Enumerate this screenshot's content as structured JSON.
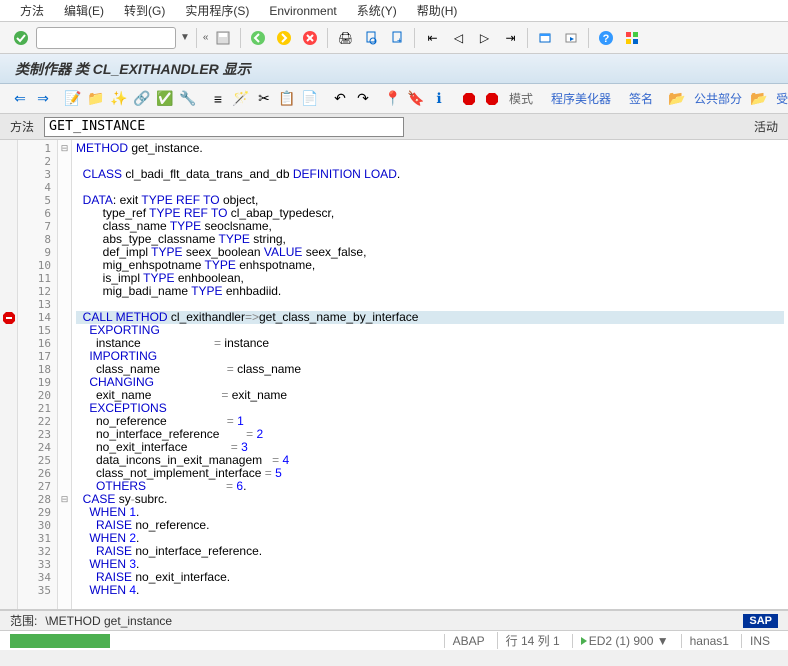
{
  "menu": {
    "items": [
      "方法",
      "编辑(E)",
      "转到(G)",
      "实用程序(S)",
      "Environment",
      "系统(Y)",
      "帮助(H)"
    ]
  },
  "title": "类制作器 类 CL_EXITHANDLER 显示",
  "toolbar2": {
    "pattern": "模式",
    "beautifier": "程序美化器",
    "signature": "签名",
    "public": "公共部分",
    "protected": "受保护"
  },
  "field": {
    "label": "方法",
    "value": "GET_INSTANCE",
    "active": "活动"
  },
  "code": {
    "lines": [
      [
        {
          "t": "METHOD",
          "c": "kw"
        },
        {
          "t": " get_instance."
        }
      ],
      [],
      [
        {
          "t": "  "
        },
        {
          "t": "CLASS",
          "c": "kw"
        },
        {
          "t": " cl_badi_flt_data_trans_and_db "
        },
        {
          "t": "DEFINITION LOAD",
          "c": "kw"
        },
        {
          "t": "."
        }
      ],
      [],
      [
        {
          "t": "  "
        },
        {
          "t": "DATA",
          "c": "kw"
        },
        {
          "t": ": exit "
        },
        {
          "t": "TYPE REF TO",
          "c": "kw"
        },
        {
          "t": " object,"
        }
      ],
      [
        {
          "t": "        type_ref "
        },
        {
          "t": "TYPE REF TO",
          "c": "kw"
        },
        {
          "t": " cl_abap_typedescr,"
        }
      ],
      [
        {
          "t": "        class_name "
        },
        {
          "t": "TYPE",
          "c": "kw"
        },
        {
          "t": " seoclsname,"
        }
      ],
      [
        {
          "t": "        abs_type_classname "
        },
        {
          "t": "TYPE",
          "c": "kw"
        },
        {
          "t": " string,"
        }
      ],
      [
        {
          "t": "        def_impl "
        },
        {
          "t": "TYPE",
          "c": "kw"
        },
        {
          "t": " seex_boolean "
        },
        {
          "t": "VALUE",
          "c": "kw"
        },
        {
          "t": " seex_false,"
        }
      ],
      [
        {
          "t": "        mig_enhspotname "
        },
        {
          "t": "TYPE",
          "c": "kw"
        },
        {
          "t": " enhspotname,"
        }
      ],
      [
        {
          "t": "        is_impl "
        },
        {
          "t": "TYPE",
          "c": "kw"
        },
        {
          "t": " enhboolean,"
        }
      ],
      [
        {
          "t": "        mig_badi_name "
        },
        {
          "t": "TYPE",
          "c": "kw"
        },
        {
          "t": " enhbadiid."
        }
      ],
      [],
      [
        {
          "t": "  "
        },
        {
          "t": "CALL METHOD",
          "c": "kw"
        },
        {
          "t": " cl_exithandler"
        },
        {
          "t": "=>",
          "c": "op"
        },
        {
          "t": "get_class_name_by_interface"
        }
      ],
      [
        {
          "t": "    "
        },
        {
          "t": "EXPORTING",
          "c": "kw"
        }
      ],
      [
        {
          "t": "      instance                      "
        },
        {
          "t": "=",
          "c": "op"
        },
        {
          "t": " instance"
        }
      ],
      [
        {
          "t": "    "
        },
        {
          "t": "IMPORTING",
          "c": "kw"
        }
      ],
      [
        {
          "t": "      class_name                    "
        },
        {
          "t": "=",
          "c": "op"
        },
        {
          "t": " class_name"
        }
      ],
      [
        {
          "t": "    "
        },
        {
          "t": "CHANGING",
          "c": "kw"
        }
      ],
      [
        {
          "t": "      exit_name                     "
        },
        {
          "t": "=",
          "c": "op"
        },
        {
          "t": " exit_name"
        }
      ],
      [
        {
          "t": "    "
        },
        {
          "t": "EXCEPTIONS",
          "c": "kw"
        }
      ],
      [
        {
          "t": "      no_reference                  "
        },
        {
          "t": "=",
          "c": "op"
        },
        {
          "t": " "
        },
        {
          "t": "1",
          "c": "num"
        }
      ],
      [
        {
          "t": "      no_interface_reference        "
        },
        {
          "t": "=",
          "c": "op"
        },
        {
          "t": " "
        },
        {
          "t": "2",
          "c": "num"
        }
      ],
      [
        {
          "t": "      no_exit_interface             "
        },
        {
          "t": "=",
          "c": "op"
        },
        {
          "t": " "
        },
        {
          "t": "3",
          "c": "num"
        }
      ],
      [
        {
          "t": "      data_incons_in_exit_managem   "
        },
        {
          "t": "=",
          "c": "op"
        },
        {
          "t": " "
        },
        {
          "t": "4",
          "c": "num"
        }
      ],
      [
        {
          "t": "      class_not_implement_interface "
        },
        {
          "t": "=",
          "c": "op"
        },
        {
          "t": " "
        },
        {
          "t": "5",
          "c": "num"
        }
      ],
      [
        {
          "t": "      "
        },
        {
          "t": "OTHERS",
          "c": "kw"
        },
        {
          "t": "                        "
        },
        {
          "t": "=",
          "c": "op"
        },
        {
          "t": " "
        },
        {
          "t": "6",
          "c": "num"
        },
        {
          "t": "."
        }
      ],
      [
        {
          "t": "  "
        },
        {
          "t": "CASE",
          "c": "kw"
        },
        {
          "t": " sy"
        },
        {
          "t": "-",
          "c": "op"
        },
        {
          "t": "subrc."
        }
      ],
      [
        {
          "t": "    "
        },
        {
          "t": "WHEN",
          "c": "kw"
        },
        {
          "t": " "
        },
        {
          "t": "1",
          "c": "num"
        },
        {
          "t": "."
        }
      ],
      [
        {
          "t": "      "
        },
        {
          "t": "RAISE",
          "c": "kw"
        },
        {
          "t": " no_reference."
        }
      ],
      [
        {
          "t": "    "
        },
        {
          "t": "WHEN",
          "c": "kw"
        },
        {
          "t": " "
        },
        {
          "t": "2",
          "c": "num"
        },
        {
          "t": "."
        }
      ],
      [
        {
          "t": "      "
        },
        {
          "t": "RAISE",
          "c": "kw"
        },
        {
          "t": " no_interface_reference."
        }
      ],
      [
        {
          "t": "    "
        },
        {
          "t": "WHEN",
          "c": "kw"
        },
        {
          "t": " "
        },
        {
          "t": "3",
          "c": "num"
        },
        {
          "t": "."
        }
      ],
      [
        {
          "t": "      "
        },
        {
          "t": "RAISE",
          "c": "kw"
        },
        {
          "t": " no_exit_interface."
        }
      ],
      [
        {
          "t": "    "
        },
        {
          "t": "WHEN",
          "c": "kw"
        },
        {
          "t": " "
        },
        {
          "t": "4",
          "c": "num"
        },
        {
          "t": "."
        }
      ]
    ],
    "highlight_line": 14,
    "fold_markers": {
      "1": "⊟",
      "28": "⊟"
    },
    "breakpoint_line": 14
  },
  "status": {
    "scope_label": "范围:",
    "scope_path": "\\METHOD get_instance",
    "lang": "ABAP",
    "pos": "行 14 列    1",
    "sys": "ED2 (1) 900",
    "server": "hanas1",
    "mode": "INS"
  }
}
